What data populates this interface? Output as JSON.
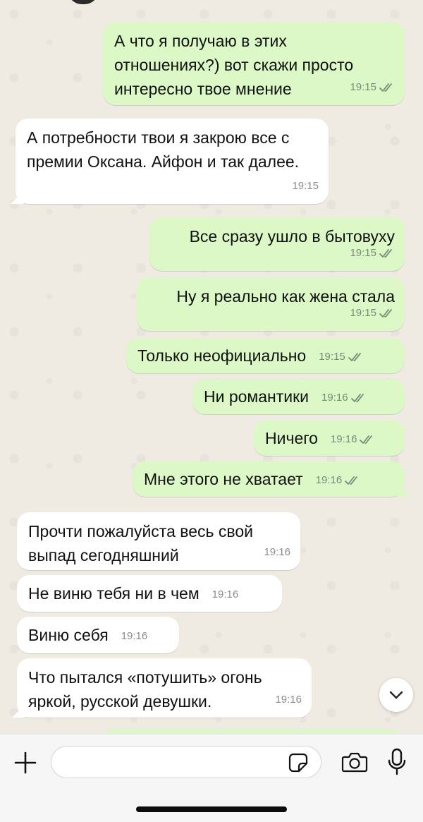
{
  "colors": {
    "chat_background": "#efeae2",
    "outgoing_bubble": "#dcf8c6",
    "incoming_bubble": "#ffffff",
    "tick_color": "#7a8a7a"
  },
  "messages": [
    {
      "direction": "outgoing",
      "text": "А что я получаю в этих отношениях?) вот скажи просто интересно твое мнение",
      "time": "19:15",
      "status_icon": "double-check-icon"
    },
    {
      "direction": "incoming",
      "text": "А потребности твои я закрою все с премии Оксана. Айфон и так далее.",
      "time": "19:15"
    },
    {
      "direction": "outgoing",
      "text": "Все сразу ушло в бытовуху",
      "time": "19:15",
      "status_icon": "double-check-icon"
    },
    {
      "direction": "outgoing",
      "text": "Ну я реально как жена стала",
      "time": "19:15",
      "status_icon": "double-check-icon"
    },
    {
      "direction": "outgoing",
      "text": "Только неофициально",
      "time": "19:15",
      "status_icon": "double-check-icon"
    },
    {
      "direction": "outgoing",
      "text": "Ни романтики",
      "time": "19:16",
      "status_icon": "double-check-icon"
    },
    {
      "direction": "outgoing",
      "text": "Ничего",
      "time": "19:16",
      "status_icon": "double-check-icon"
    },
    {
      "direction": "outgoing",
      "text": "Мне этого не хватает",
      "time": "19:16",
      "status_icon": "double-check-icon"
    },
    {
      "direction": "incoming",
      "text": "Прочти пожалуйста весь свой выпад сегодняшний",
      "time": "19:16"
    },
    {
      "direction": "incoming",
      "text": "Не виню тебя ни в чем",
      "time": "19:16"
    },
    {
      "direction": "incoming",
      "text": "Виню себя",
      "time": "19:16"
    },
    {
      "direction": "incoming",
      "text": "Что пытался «потушить» огонь яркой, русской девушки.",
      "time": "19:16"
    }
  ],
  "composer": {
    "input_value": "",
    "icons": [
      "plus-icon",
      "sticker-icon",
      "camera-icon",
      "microphone-icon"
    ]
  },
  "scroll_button_icon": "chevron-down-icon"
}
